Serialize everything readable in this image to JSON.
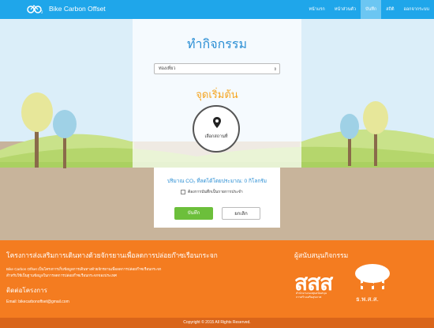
{
  "app": {
    "brand_name": "Bike Carbon Offset",
    "accent_color": "#1fa6ea",
    "footer_color": "#f47c20"
  },
  "nav": {
    "items": [
      {
        "label": "หน้าแรก",
        "active": false
      },
      {
        "label": "หน้าส่วนตัว",
        "active": false
      },
      {
        "label": "บันทึก",
        "active": true
      },
      {
        "label": "สถิติ",
        "active": false
      },
      {
        "label": "ออกจากระบบ",
        "active": false
      }
    ]
  },
  "activity": {
    "title": "ทำกิจกรรม",
    "select_value": "ท่องเที่ยว",
    "start_title": "จุดเริ่มต้น",
    "pick_location_label": "เลือกสถานที่",
    "co2_text": "ปริมาณ CO₂ ที่ลดได้โดยประมาณ: 0 กิโลกรัม",
    "recurring_label": "ต้องการบันทึกเป็นรายการประจำ",
    "save_label": "บันทึก",
    "cancel_label": "ยกเลิก"
  },
  "footer": {
    "project_title": "โครงการส่งเสริมการเดินทางด้วยจักรยานเพื่อลดการปล่อยก๊าซเรือนกระจก",
    "description_1": "Bike Carbon Offset เป็นโครงการเก็บข้อมูลการเดินทางด้วยจักรยานเพื่อลดการปล่อยก๊าซเรือนกระจก",
    "description_2": "สำหรับใช้เป็นฐานข้อมูลในการลดการปล่อยก๊าซเรือนกระจกของประเทศ",
    "contact_title": "ติดต่อโครงการ",
    "email": "Email: bikecarbonoffset@gmail.com",
    "support_title": "ผู้สนับสนุนกิจกรรม",
    "sponsor_logo_text": "สสส",
    "sponsor_sub_1": "สำนักงานกองทุนสนับสนุน",
    "sponsor_sub_2": "การสร้างเสริมสุขภาพ",
    "org_logo_text": "ธ.พ.ส.ส.",
    "copyright": "Copyright © 2015 All Rights Reserved."
  }
}
